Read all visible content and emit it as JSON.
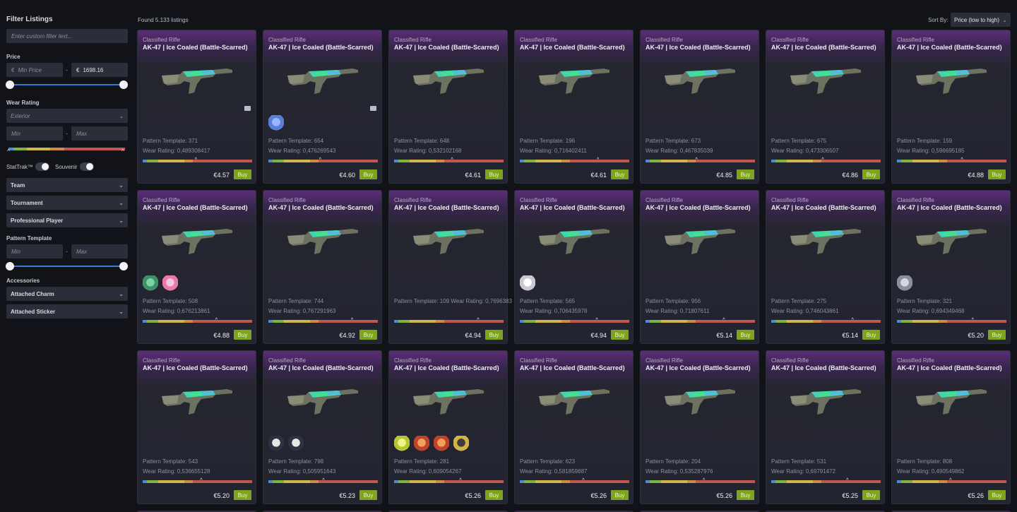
{
  "sidebar": {
    "title": "Filter Listings",
    "filter_placeholder": "Enter custom filter text...",
    "price_label": "Price",
    "min_price_placeholder": "Min Price",
    "currency": "€",
    "max_price_value": "1698.16",
    "wear_label": "Wear Rating",
    "exterior_placeholder": "Exterior",
    "min_placeholder": "Min",
    "max_placeholder": "Max",
    "stattrak_label": "StatTrak™",
    "souvenir_label": "Souvenir",
    "team_label": "Team",
    "tournament_label": "Tournament",
    "pro_label": "Professional Player",
    "pattern_label": "Pattern Template",
    "accessories_label": "Accessories",
    "charm_label": "Attached Charm",
    "sticker_label": "Attached Sticker"
  },
  "header": {
    "found": "Found 5.133 listings",
    "sort_label": "Sort By:",
    "sort_value": "Price (low to high)"
  },
  "common": {
    "rarity": "Classified Rifle",
    "name": "AK-47 | Ice Coaled (Battle-Scarred)",
    "buy": "Buy"
  },
  "listings": [
    {
      "pattern": "Pattern Template: 371",
      "wear": "Wear Rating: 0,489308417",
      "wear_fraction": 0.489,
      "price": "€4.57"
    },
    {
      "pattern": "Pattern Template: 654",
      "wear": "Wear Rating: 0,476269543",
      "wear_fraction": 0.476,
      "price": "€4.60"
    },
    {
      "pattern": "Pattern Template: 648",
      "wear": "Wear Rating: 0,532102168",
      "wear_fraction": 0.532,
      "price": "€4.61"
    },
    {
      "pattern": "Pattern Template: 196",
      "wear": "Wear Rating: 0,716402411",
      "wear_fraction": 0.716,
      "price": "€4.61"
    },
    {
      "pattern": "Pattern Template: 673",
      "wear": "Wear Rating: 0,467835039",
      "wear_fraction": 0.468,
      "price": "€4.85"
    },
    {
      "pattern": "Pattern Template: 675",
      "wear": "Wear Rating: 0,473306507",
      "wear_fraction": 0.473,
      "price": "€4.86"
    },
    {
      "pattern": "Pattern Template: 159",
      "wear": "Wear Rating: 0,596695185",
      "wear_fraction": 0.597,
      "price": "€4.88"
    },
    {
      "pattern": "Pattern Template: 508",
      "wear": "Wear Rating: 0,676213861",
      "wear_fraction": 0.676,
      "price": "€4.88"
    },
    {
      "pattern": "Pattern Template: 744",
      "wear": "Wear Rating: 0,767291963",
      "wear_fraction": 0.767,
      "price": "€4.92"
    },
    {
      "pattern": "Pattern Template: 109  Wear Rating: 0,7696383",
      "wear": "",
      "wear_fraction": 0.77,
      "price": "€4.94"
    },
    {
      "pattern": "Pattern Template: 565",
      "wear": "Wear Rating: 0,706435978",
      "wear_fraction": 0.706,
      "price": "€4.94"
    },
    {
      "pattern": "Pattern Template: 956",
      "wear": "Wear Rating: 0,71807611",
      "wear_fraction": 0.718,
      "price": "€5.14"
    },
    {
      "pattern": "Pattern Template: 275",
      "wear": "Wear Rating: 0,746043861",
      "wear_fraction": 0.746,
      "price": "€5.14"
    },
    {
      "pattern": "Pattern Template: 321",
      "wear": "Wear Rating: 0,694349468",
      "wear_fraction": 0.694,
      "price": "€5.20"
    },
    {
      "pattern": "Pattern Template: 543",
      "wear": "Wear Rating: 0,536655128",
      "wear_fraction": 0.537,
      "price": "€5.20"
    },
    {
      "pattern": "Pattern Template: 798",
      "wear": "Wear Rating: 0,505951643",
      "wear_fraction": 0.506,
      "price": "€5.23"
    },
    {
      "pattern": "Pattern Template: 281",
      "wear": "Wear Rating: 0,609054267",
      "wear_fraction": 0.609,
      "price": "€5.26"
    },
    {
      "pattern": "Pattern Template: 623",
      "wear": "Wear Rating: 0,581859887",
      "wear_fraction": 0.582,
      "price": "€5.26"
    },
    {
      "pattern": "Pattern Template: 204",
      "wear": "Wear Rating: 0,535287976",
      "wear_fraction": 0.535,
      "price": "€5.26"
    },
    {
      "pattern": "Pattern Template: 531",
      "wear": "Wear Rating: 0,69791472",
      "wear_fraction": 0.698,
      "price": "€5.25"
    },
    {
      "pattern": "Pattern Template: 808",
      "wear": "Wear Rating: 0,490549862",
      "wear_fraction": 0.491,
      "price": "€5.26"
    }
  ],
  "colors": {
    "buy": "#7ea31d",
    "accent": "#3a7bd5",
    "rarity": "#5c2d78"
  }
}
